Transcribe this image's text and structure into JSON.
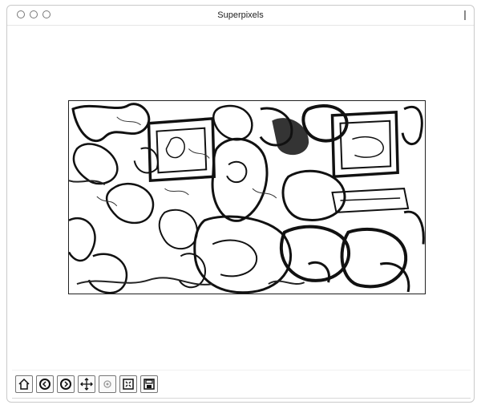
{
  "window": {
    "title": "Superpixels"
  },
  "toolbar": {
    "buttons": [
      {
        "icon": "home-icon",
        "name": "home-button"
      },
      {
        "icon": "back-icon",
        "name": "back-button"
      },
      {
        "icon": "forward-icon",
        "name": "forward-button"
      },
      {
        "icon": "pan-icon",
        "name": "pan-button"
      },
      {
        "icon": "zoom-icon",
        "name": "zoom-button"
      },
      {
        "icon": "configure-subplots-icon",
        "name": "configure-subplots-button"
      },
      {
        "icon": "save-icon",
        "name": "save-button"
      }
    ]
  }
}
